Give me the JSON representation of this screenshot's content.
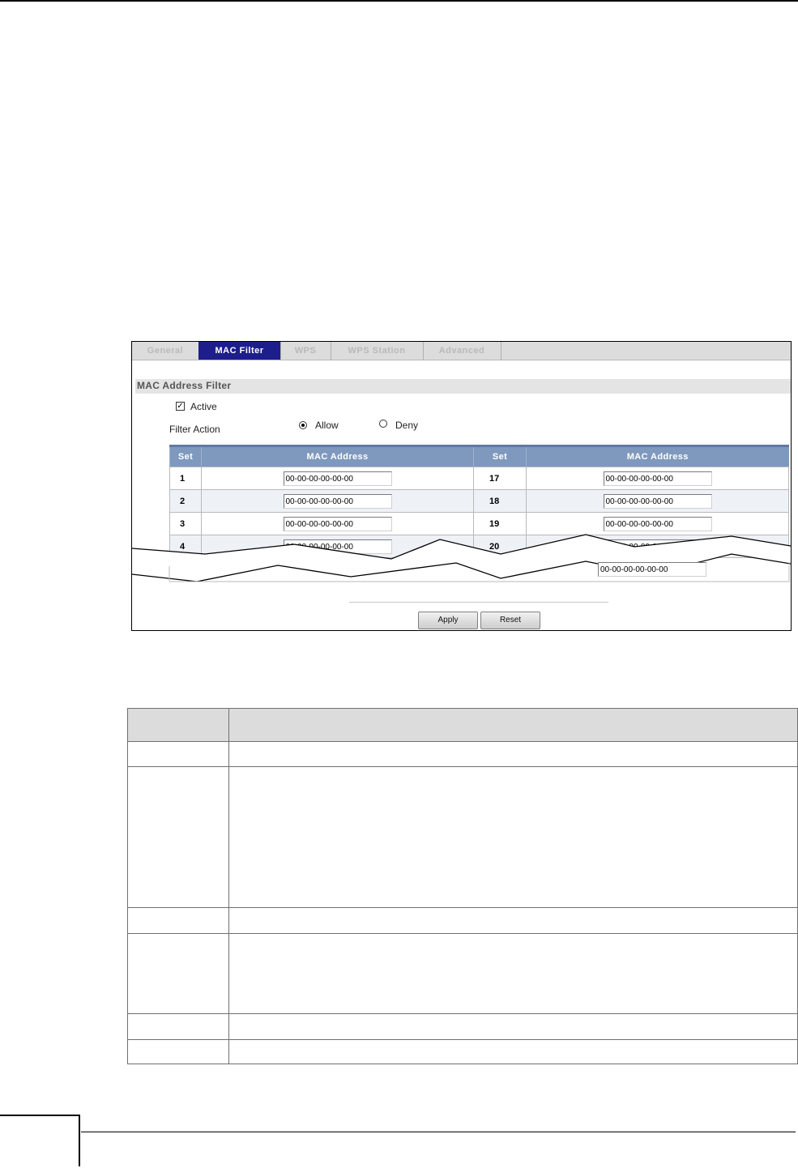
{
  "tabs": [
    {
      "label": "General",
      "active": false
    },
    {
      "label": "MAC Filter",
      "active": true
    },
    {
      "label": "WPS",
      "active": false
    },
    {
      "label": "WPS Station",
      "active": false
    },
    {
      "label": "Advanced",
      "active": false
    }
  ],
  "section_title": "MAC Address Filter",
  "active": {
    "label": "Active",
    "checked": true
  },
  "filter_action": {
    "label": "Filter Action",
    "options": [
      {
        "label": "Allow",
        "selected": true
      },
      {
        "label": "Deny",
        "selected": false
      }
    ]
  },
  "table": {
    "headers": [
      "Set",
      "MAC Address",
      "Set",
      "MAC Address"
    ],
    "rows": [
      {
        "set_left": "1",
        "mac_left": "00-00-00-00-00-00",
        "set_right": "17",
        "mac_right": "00-00-00-00-00-00"
      },
      {
        "set_left": "2",
        "mac_left": "00-00-00-00-00-00",
        "set_right": "18",
        "mac_right": "00-00-00-00-00-00"
      },
      {
        "set_left": "3",
        "mac_left": "00-00-00-00-00-00",
        "set_right": "19",
        "mac_right": "00-00-00-00-00-00"
      },
      {
        "set_left": "4",
        "mac_left": "00-00-00-00-00-00",
        "set_right": "20",
        "mac_right": "00-00-00-00-00-00"
      }
    ],
    "last_visible_mac": "00-00-00-00-00-00"
  },
  "buttons": {
    "apply": "Apply",
    "reset": "Reset"
  },
  "colors": {
    "active_tab": "#1d1e8c",
    "table_header": "#7f98bd",
    "alt_row": "#eef2f7"
  }
}
